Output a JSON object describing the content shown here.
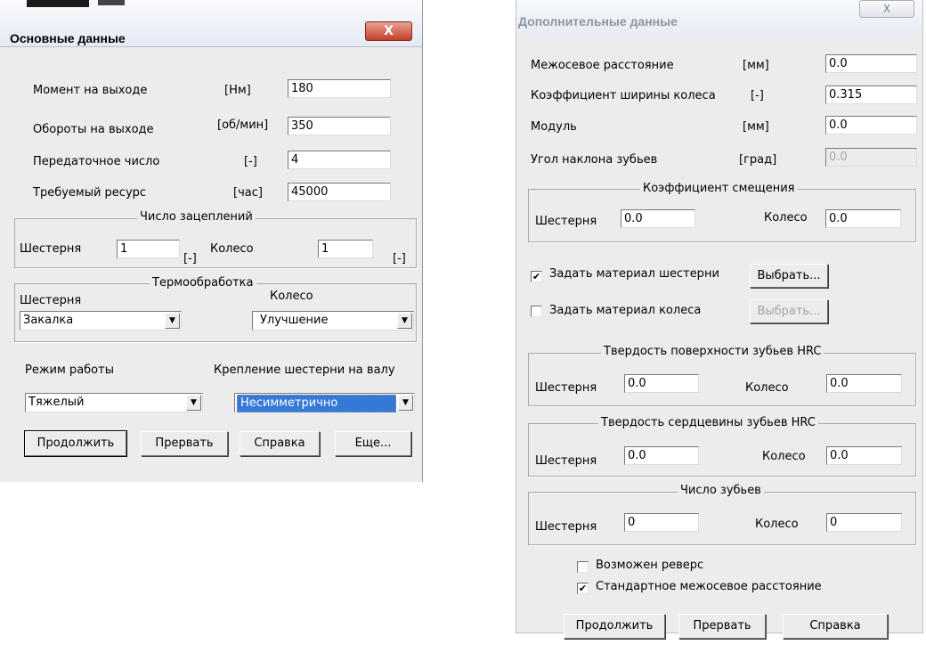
{
  "main_dialog": {
    "title": "Основные данные",
    "close_glyph": "X",
    "fields": [
      {
        "label": "Момент на выходе",
        "unit": "[Нм]",
        "value": "180"
      },
      {
        "label": "Обороты на выходе",
        "unit": "[об/мин]",
        "value": "350"
      },
      {
        "label": "Передаточное число",
        "unit": "[-]",
        "value": "4"
      },
      {
        "label": "Требуемый ресурс",
        "unit": "[час]",
        "value": "45000"
      }
    ],
    "engagements": {
      "legend": "Число зацеплений",
      "pinion_label": "Шестерня",
      "pinion_value": "1",
      "pinion_unit": "[-]",
      "wheel_label": "Колесо",
      "wheel_value": "1",
      "wheel_unit": "[-]"
    },
    "heat_treatment": {
      "legend": "Термообработка",
      "pinion_label": "Шестерня",
      "pinion_value": "Закалка",
      "wheel_label": "Колесо",
      "wheel_value": "Улучшение"
    },
    "mode_label": "Режим работы",
    "mode_value": "Тяжелый",
    "mount_label": "Крепление шестерни на валу",
    "mount_value": "Несимметрично",
    "buttons": {
      "continue": "Продолжить",
      "abort": "Прервать",
      "help": "Справка",
      "more": "Еще..."
    }
  },
  "extra_dialog": {
    "title": "Дополнительные данные",
    "close_glyph": "X",
    "fields": [
      {
        "label": "Межосевое расстояние",
        "unit": "[мм]",
        "value": "0.0"
      },
      {
        "label": "Коэффициент ширины колеса",
        "unit": "[-]",
        "value": "0.315"
      },
      {
        "label": "Модуль",
        "unit": "[мм]",
        "value": "0.0"
      },
      {
        "label": "Угол наклона зубьев",
        "unit": "[град]",
        "value": "0.0"
      }
    ],
    "shift": {
      "legend": "Коэффициент смещения",
      "pinion_label": "Шестерня",
      "pinion_value": "0.0",
      "wheel_label": "Колесо",
      "wheel_value": "0.0"
    },
    "set_pinion_material": {
      "label": "Задать материал шестерни",
      "checked": true,
      "button": "Выбрать..."
    },
    "set_wheel_material": {
      "label": "Задать материал колеса",
      "checked": false,
      "button": "Выбрать..."
    },
    "surface_hardness": {
      "legend": "Твердость поверхности зубьев HRC",
      "pinion_label": "Шестерня",
      "pinion_value": "0.0",
      "wheel_label": "Колесо",
      "wheel_value": "0.0"
    },
    "core_hardness": {
      "legend": "Твердость сердцевины зубьев HRC",
      "pinion_label": "Шестерня",
      "pinion_value": "0.0",
      "wheel_label": "Колесо",
      "wheel_value": "0.0"
    },
    "teeth": {
      "legend": "Число зубьев",
      "pinion_label": "Шестерня",
      "pinion_value": "0",
      "wheel_label": "Колесо",
      "wheel_value": "0"
    },
    "reverse": {
      "label": "Возможен реверс",
      "checked": false
    },
    "standard_distance": {
      "label": "Стандартное межосевое расстояние",
      "checked": true
    },
    "buttons": {
      "continue": "Продолжить",
      "abort": "Прервать",
      "help": "Справка"
    }
  }
}
